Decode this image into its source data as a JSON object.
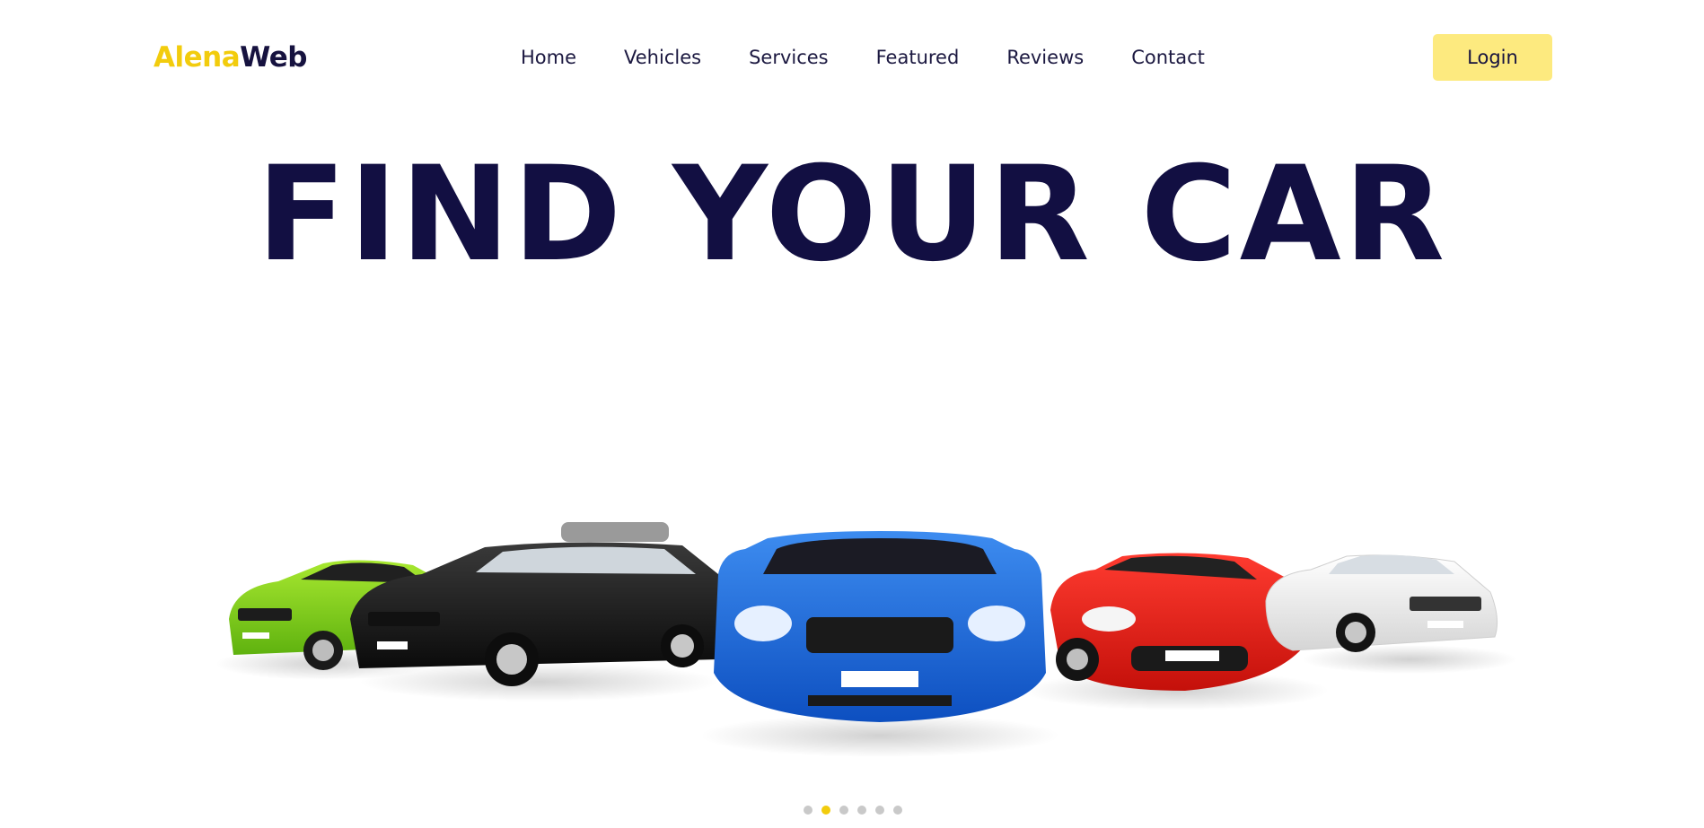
{
  "brand": {
    "part1": "Alena",
    "part2": "Web"
  },
  "nav": {
    "links": [
      "Home",
      "Vehicles",
      "Services",
      "Featured",
      "Reviews",
      "Contact"
    ],
    "login_label": "Login"
  },
  "hero": {
    "title": "FIND YOUR CAR",
    "cars": [
      "green-hatchback",
      "black-station-wagon",
      "blue-sedan",
      "red-sports-car",
      "white-convertible"
    ]
  },
  "carousel": {
    "total_slides": 6,
    "active_index": 1
  },
  "colors": {
    "accent": "#f2cc0d",
    "navy": "#120f42",
    "login_bg": "#fdea7f",
    "dot_inactive": "#c9c9c9"
  }
}
